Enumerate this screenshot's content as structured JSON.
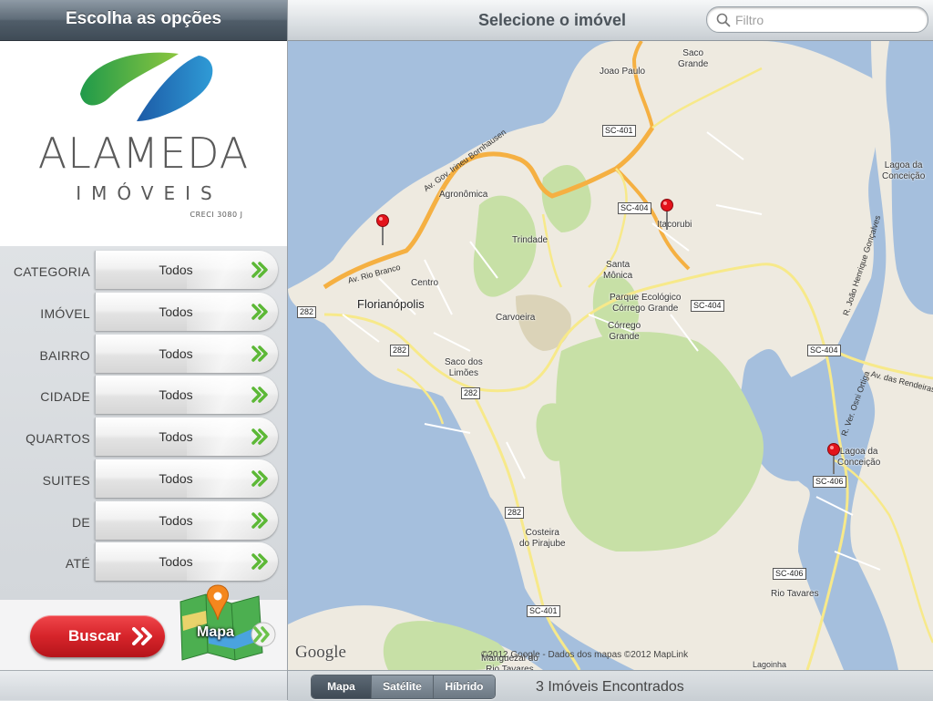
{
  "left": {
    "header": "Escolha as opções",
    "logo": {
      "title": "ALAMEDA",
      "subtitle": "IMÓVEIS",
      "creci": "CRECI 3080 J"
    },
    "filters": [
      {
        "label": "CATEGORIA",
        "value": "Todos"
      },
      {
        "label": "IMÓVEL",
        "value": "Todos"
      },
      {
        "label": "BAIRRO",
        "value": "Todos"
      },
      {
        "label": "CIDADE",
        "value": "Todos"
      },
      {
        "label": "QUARTOS",
        "value": "Todos"
      },
      {
        "label": "SUITES",
        "value": "Todos"
      },
      {
        "label": "DE",
        "value": "Todos"
      },
      {
        "label": "ATÉ",
        "value": "Todos"
      }
    ],
    "search_button": "Buscar",
    "map_button": "Mapa",
    "colors": {
      "arrow_green": "#6cc24a",
      "buscar_red": "#d6242a"
    }
  },
  "right": {
    "title": "Selecione o imóvel",
    "search_placeholder": "Filtro",
    "map": {
      "labels": {
        "saco_grande": "Saco\nGrande",
        "joao_paulo": "Joao Paulo",
        "agronomica": "Agronômica",
        "itacorubi": "Itacorubi",
        "trindade": "Trindade",
        "santa_monica": "Santa\nMônica",
        "centro": "Centro",
        "florianopolis": "Florianópolis",
        "parque": "Parque Ecológico\nCórrego Grande",
        "carvoeira": "Carvoeira",
        "corrego_grande": "Córrego\nGrande",
        "saco_limoes": "Saco dos\nLimões",
        "lagoa_conceicao_top": "Lagoa da\nConceição",
        "lagoa_conceicao": "Lagoa da\nConceição",
        "costeira": "Costeira\ndo Pirajube",
        "rio_tavares": "Rio Tavares",
        "manguezal": "Manguezal do\nRio Tavares",
        "lagoinha": "Lagoinha"
      },
      "shields": [
        "SC-401",
        "SC-404",
        "SC-404",
        "SC-404",
        "282",
        "282",
        "282",
        "282",
        "SC-406",
        "SC-406",
        "SC-401"
      ],
      "road_names": [
        "Av. Gov. Irineu Bornhausen",
        "Av. Rio Branco",
        "R. João Henrique Gonçalves",
        "Av. das Rendeiras",
        "R. Ver. Osni Ortiga"
      ],
      "google": "Google",
      "attribution": "©2012 Google - Dados dos mapas ©2012 MapLink",
      "pins": [
        "pin-1",
        "pin-2",
        "pin-3"
      ]
    },
    "map_types": [
      {
        "label": "Mapa",
        "selected": true
      },
      {
        "label": "Satélite",
        "selected": false
      },
      {
        "label": "Híbrido",
        "selected": false
      }
    ],
    "results": "3 Imóveis Encontrados"
  }
}
